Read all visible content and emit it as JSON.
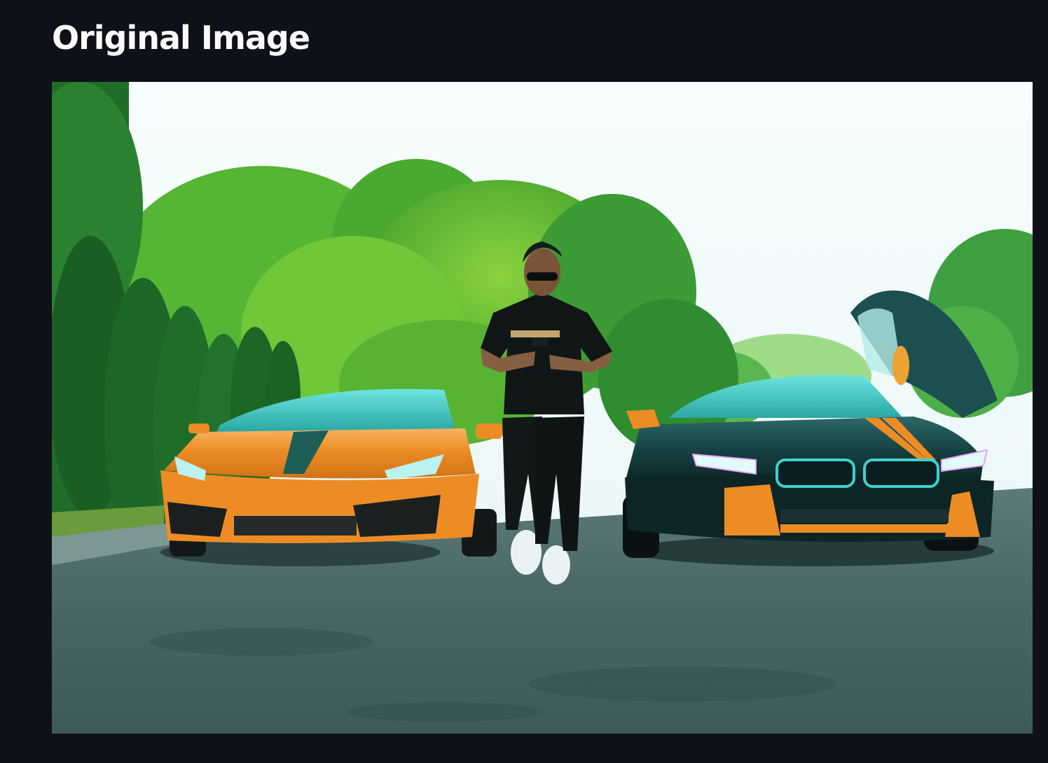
{
  "page": {
    "title": "Original Image"
  },
  "image": {
    "subject": "photo"
  },
  "colors": {
    "background": "#0e1118",
    "title_text": "#fafafa",
    "orange_car": "#f58a1f",
    "dark_car": "#0f2a2b",
    "teal_accent": "#3fd3cf"
  }
}
